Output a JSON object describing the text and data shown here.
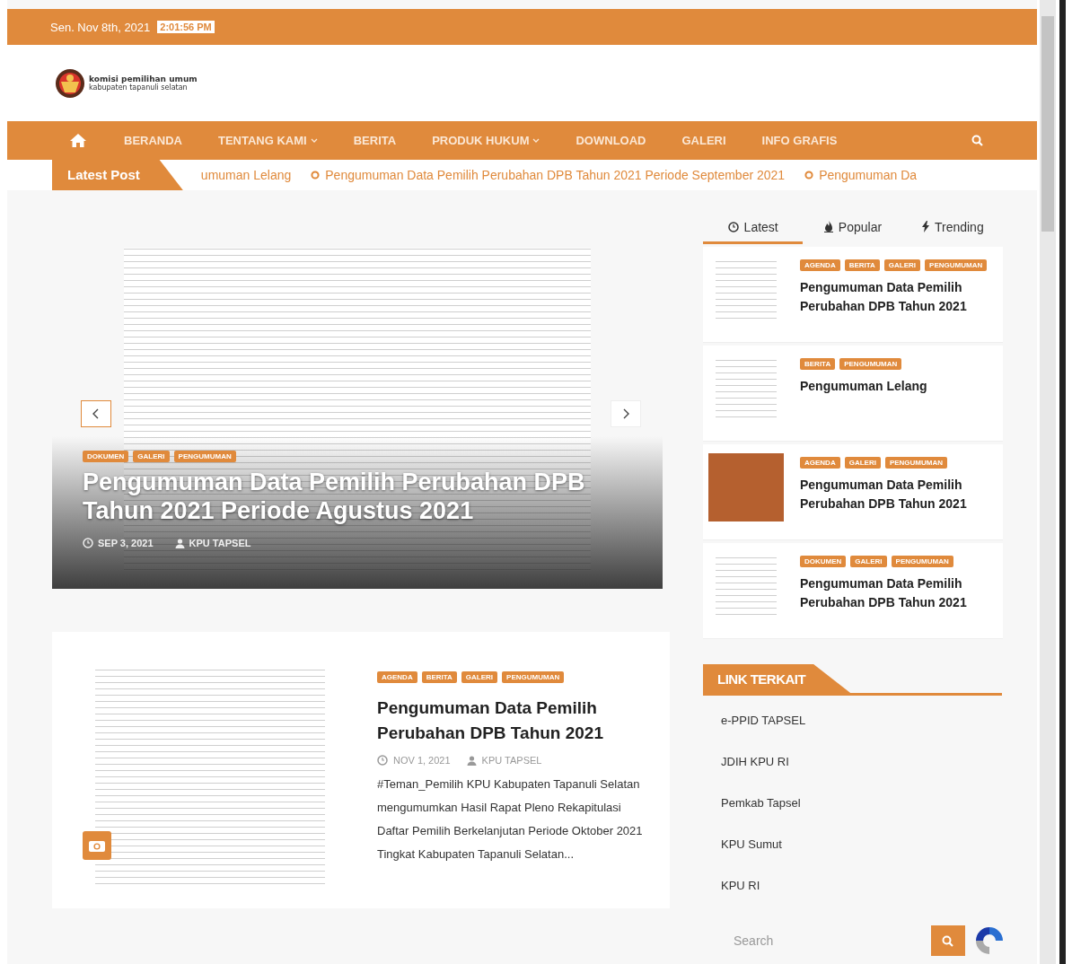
{
  "topbar": {
    "date": "Sen. Nov 8th, 2021",
    "time": "2:01:56 PM"
  },
  "logo": {
    "line1": "komisi pemilihan umum",
    "line2": "kabupaten tapanuli selatan"
  },
  "nav": {
    "items": [
      {
        "label": "BERANDA",
        "dropdown": false
      },
      {
        "label": "TENTANG KAMI",
        "dropdown": true
      },
      {
        "label": "BERITA",
        "dropdown": false
      },
      {
        "label": "PRODUK HUKUM",
        "dropdown": true
      },
      {
        "label": "DOWNLOAD",
        "dropdown": false
      },
      {
        "label": "GALERI",
        "dropdown": false
      },
      {
        "label": "INFO GRAFIS",
        "dropdown": false
      }
    ]
  },
  "ticker": {
    "label": "Latest Post",
    "items": [
      {
        "text": "umuman Lelang",
        "bullet": false
      },
      {
        "text": "Pengumuman Data Pemilih Perubahan DPB Tahun 2021 Periode September 2021",
        "bullet": true
      },
      {
        "text": "Pengumuman Da",
        "bullet": true
      }
    ]
  },
  "slider": {
    "tags": [
      "DOKUMEN",
      "GALERI",
      "PENGUMUMAN"
    ],
    "title": "Pengumuman Data Pemilih Perubahan DPB Tahun 2021 Periode Agustus 2021",
    "date": "SEP 3, 2021",
    "author": "KPU TAPSEL"
  },
  "sidebar_tabs": [
    {
      "label": "Latest",
      "kind": "clock",
      "selected": true
    },
    {
      "label": "Popular",
      "kind": "flame",
      "selected": false
    },
    {
      "label": "Trending",
      "kind": "bolt",
      "selected": false
    }
  ],
  "sidebar_posts": [
    {
      "kind": "document",
      "tags": [
        "AGENDA",
        "BERITA",
        "GALERI",
        "PENGUMUMAN"
      ],
      "title": "Pengumuman Data Pemilih Perubahan DPB Tahun 2021"
    },
    {
      "kind": "document",
      "tags": [
        "BERITA",
        "PENGUMUMAN"
      ],
      "title": "Pengumuman Lelang"
    },
    {
      "kind": "photo",
      "tags": [
        "AGENDA",
        "GALERI",
        "PENGUMUMAN"
      ],
      "title": "Pengumuman Data Pemilih Perubahan DPB Tahun 2021"
    },
    {
      "kind": "document",
      "tags": [
        "DOKUMEN",
        "GALERI",
        "PENGUMUMAN"
      ],
      "title": "Pengumuman Data Pemilih Perubahan DPB Tahun 2021"
    }
  ],
  "featured_post": {
    "tags": [
      "AGENDA",
      "BERITA",
      "GALERI",
      "PENGUMUMAN"
    ],
    "title": "Pengumuman Data Pemilih Perubahan DPB Tahun 2021",
    "date": "NOV 1, 2021",
    "author": "KPU TAPSEL",
    "excerpt": "#Teman_Pemilih KPU Kabupaten Tapanuli Selatan mengumumkan Hasil Rapat Pleno Rekapitulasi Daftar Pemilih Berkelanjutan Periode Oktober 2021 Tingkat Kabupaten Tapanuli Selatan..."
  },
  "links": {
    "title": "LINK TERKAIT",
    "items": [
      "e-PPID TAPSEL",
      "JDIH KPU RI",
      "Pemkab Tapsel",
      "KPU Sumut",
      "KPU RI"
    ]
  },
  "search": {
    "placeholder": "Search"
  }
}
